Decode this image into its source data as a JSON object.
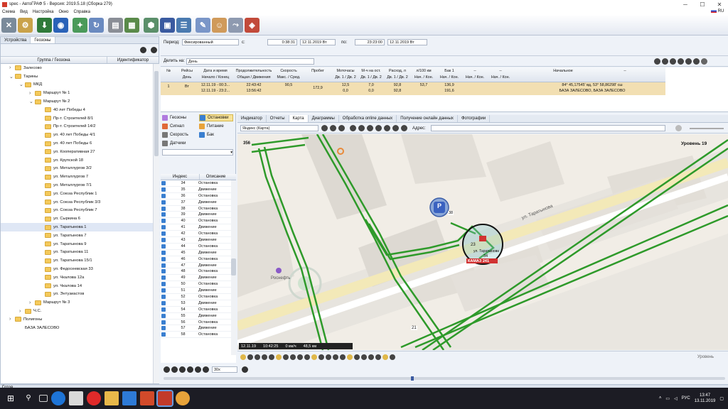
{
  "window": {
    "title": "spec - АвтоГРАФ 5 - Версия: 2019.5.18 (Сборка 279)",
    "lang": "RU"
  },
  "menu": [
    "Схема",
    "Вид",
    "Настройка",
    "Окно",
    "Справка"
  ],
  "left": {
    "tabs": [
      "Устройства",
      "Геозоны"
    ],
    "col_group": "Группа / Геозона",
    "col_id": "Идентификатор",
    "tree": [
      {
        "label": "Залесово",
        "level": 0,
        "exp": "›"
      },
      {
        "label": "Тарины",
        "level": 0,
        "exp": "⌄"
      },
      {
        "label": "МКД",
        "level": 1,
        "exp": "⌄"
      },
      {
        "label": "Маршрут № 1",
        "level": 2,
        "exp": "›"
      },
      {
        "label": "Маршрут № 2",
        "level": 2,
        "exp": "⌄"
      },
      {
        "label": "40 лет Победы 4",
        "level": 3,
        "exp": ""
      },
      {
        "label": "Пр-т. Строителей 8/1",
        "level": 3,
        "exp": ""
      },
      {
        "label": "Пр-т. Строителей 14/2",
        "level": 3,
        "exp": ""
      },
      {
        "label": "ул. 40 лет Победы 4/1",
        "level": 3,
        "exp": ""
      },
      {
        "label": "ул. 40 лет Победы 6",
        "level": 3,
        "exp": ""
      },
      {
        "label": "ул. Кооперативная 27",
        "level": 3,
        "exp": ""
      },
      {
        "label": "ул. Крупской 18",
        "level": 3,
        "exp": ""
      },
      {
        "label": "ул. Металлургов 3/2",
        "level": 3,
        "exp": ""
      },
      {
        "label": "ул. Металлургов 7",
        "level": 3,
        "exp": ""
      },
      {
        "label": "ул. Металлургов 7/1",
        "level": 3,
        "exp": ""
      },
      {
        "label": "ул. Союза Республик 1",
        "level": 3,
        "exp": ""
      },
      {
        "label": "ул. Союза Республик 3/3",
        "level": 3,
        "exp": ""
      },
      {
        "label": "ул. Союза Республик 7",
        "level": 3,
        "exp": ""
      },
      {
        "label": "ул. Сыркина 6",
        "level": 3,
        "exp": ""
      },
      {
        "label": "ул. Таратынова 1",
        "level": 3,
        "exp": "",
        "sel": true
      },
      {
        "label": "ул. Таратынова 7",
        "level": 3,
        "exp": ""
      },
      {
        "label": "ул. Таратынова 9",
        "level": 3,
        "exp": ""
      },
      {
        "label": "ул. Таратынова 11",
        "level": 3,
        "exp": ""
      },
      {
        "label": "ул. Таратынова 15/1",
        "level": 3,
        "exp": ""
      },
      {
        "label": "ул. Федосеевская 33",
        "level": 3,
        "exp": ""
      },
      {
        "label": "ул. Чкалова 12а",
        "level": 3,
        "exp": ""
      },
      {
        "label": "ул. Чкалова 14",
        "level": 3,
        "exp": ""
      },
      {
        "label": "ул. Энтузиастов",
        "level": 3,
        "exp": ""
      },
      {
        "label": "Маршрут № 3",
        "level": 2,
        "exp": "›"
      },
      {
        "label": "Ч.С.",
        "level": 1,
        "exp": "›"
      },
      {
        "label": "Полигоны",
        "level": 0,
        "exp": "›"
      },
      {
        "label": "БАЗА ЗАЛЕСОВО",
        "level": 1,
        "exp": "",
        "nofold": true
      }
    ]
  },
  "period": {
    "label": "Период:",
    "mode": "Фиксированный",
    "from_label": "с:",
    "from_time": "0:38:31",
    "from_date": "12.11.2019 Вт",
    "to_label": "по:",
    "to_time": "23:23:00",
    "to_date": "12.11.2019 Вт"
  },
  "split": {
    "label": "Делить на:",
    "value": "День"
  },
  "grid": {
    "headers": [
      [
        "№",
        ""
      ],
      [
        "Рейсы",
        "День"
      ],
      [
        "Дата и время",
        "Начало / Конец"
      ],
      [
        "Продолжительность",
        "Общая / Движения"
      ],
      [
        "Скорость",
        "Макс. / Сред."
      ],
      [
        "Пробег",
        ""
      ],
      [
        "Моточасы",
        "Дв. 1 / Дв. 2"
      ],
      [
        "М-ч на ост.",
        "Дв. 1 / Дв. 2"
      ],
      [
        "Расход, л",
        "Дв. 1 / Дв. 2"
      ],
      [
        "л/100 км",
        "Нач. / Кон."
      ],
      [
        "Бак 1",
        "Нач. / Кон."
      ],
      [
        "--",
        "Нач. / Кон."
      ],
      [
        "--",
        "Нач. / Кон."
      ],
      [
        "Начальное",
        ""
      ],
      [
        "--",
        ""
      ]
    ],
    "row": {
      "num": "1",
      "day": "Вт",
      "begin": "12.11.19 - 00:3...",
      "end": "12.11.19 - 23:2...",
      "total": "22:43:42",
      "moving": "13:56:42",
      "vmax": "90,5",
      "vavg": "",
      "mileage": "172,9",
      "mh1a": "12,5",
      "mh1b": "0,0",
      "mo1a": "7,0",
      "mo1b": "0,0",
      "fuela": "92,8",
      "fuelb": "92,8",
      "l100": "53,7",
      "tank_start": "136,9",
      "tank_end": "191,6",
      "start": "84° 45,17545' вд, 53° 58,86298' сш",
      "start2": "БАЗА ЗАЛЕСОВО, БАЗА ЗАЛЕСОВО"
    }
  },
  "layers": {
    "items": [
      {
        "label": "Геозоны",
        "color": "#b07adf"
      },
      {
        "label": "Остановки",
        "color": "#3a7fd0",
        "active": true
      },
      {
        "label": "Сигнал",
        "color": "#e06a3a"
      },
      {
        "label": "Питание",
        "color": "#e8a33a"
      },
      {
        "label": "Скорость",
        "color": "#777"
      },
      {
        "label": "Бак",
        "color": "#3a7fd0"
      },
      {
        "label": "Датчики",
        "color": "#777"
      }
    ]
  },
  "stops": {
    "col_index": "Индекс",
    "col_desc": "Описание",
    "rows": [
      [
        "34",
        "Остановка"
      ],
      [
        "35",
        "Движение"
      ],
      [
        "36",
        "Остановка"
      ],
      [
        "37",
        "Движение"
      ],
      [
        "38",
        "Остановка"
      ],
      [
        "39",
        "Движение"
      ],
      [
        "40",
        "Остановка"
      ],
      [
        "41",
        "Движение"
      ],
      [
        "42",
        "Остановка"
      ],
      [
        "43",
        "Движение"
      ],
      [
        "44",
        "Остановка"
      ],
      [
        "45",
        "Движение"
      ],
      [
        "46",
        "Остановка"
      ],
      [
        "47",
        "Движение"
      ],
      [
        "48",
        "Остановка"
      ],
      [
        "49",
        "Движение"
      ],
      [
        "50",
        "Остановка"
      ],
      [
        "51",
        "Движение"
      ],
      [
        "52",
        "Остановка"
      ],
      [
        "53",
        "Движение"
      ],
      [
        "54",
        "Остановка"
      ],
      [
        "55",
        "Движение"
      ],
      [
        "56",
        "Остановка"
      ],
      [
        "57",
        "Движение"
      ],
      [
        "58",
        "Остановка"
      ]
    ]
  },
  "map": {
    "tabs": [
      "Индикатор",
      "Отчеты",
      "Карта",
      "Диаграммы",
      "Обработка online данных",
      "Получение онлайн данных",
      "Фотографии"
    ],
    "active_tab": "Карта",
    "provider": "Яндекс (Карта)",
    "address_label": "Адрес:",
    "zoom": "Уровень 19",
    "poi": "Роснефть",
    "vehicle": "КАМАЗ 241",
    "geozone": "ул. Таратынова",
    "stop_num": "38",
    "num23": "23",
    "num34": "34",
    "num21": "21",
    "street": "ул. Таратынова",
    "road_num": "356",
    "status_date": "12.11.19",
    "status_time": "10:42:25",
    "status_speed": "0 км/ч",
    "status_dist": "48,5 км",
    "levels": "Уровень"
  },
  "playback": {
    "speed": "30x"
  },
  "statusbar": {
    "text": "Готов"
  },
  "taskbar": {
    "time": "13:47",
    "date": "13.11.2019",
    "lang": "РУС"
  }
}
